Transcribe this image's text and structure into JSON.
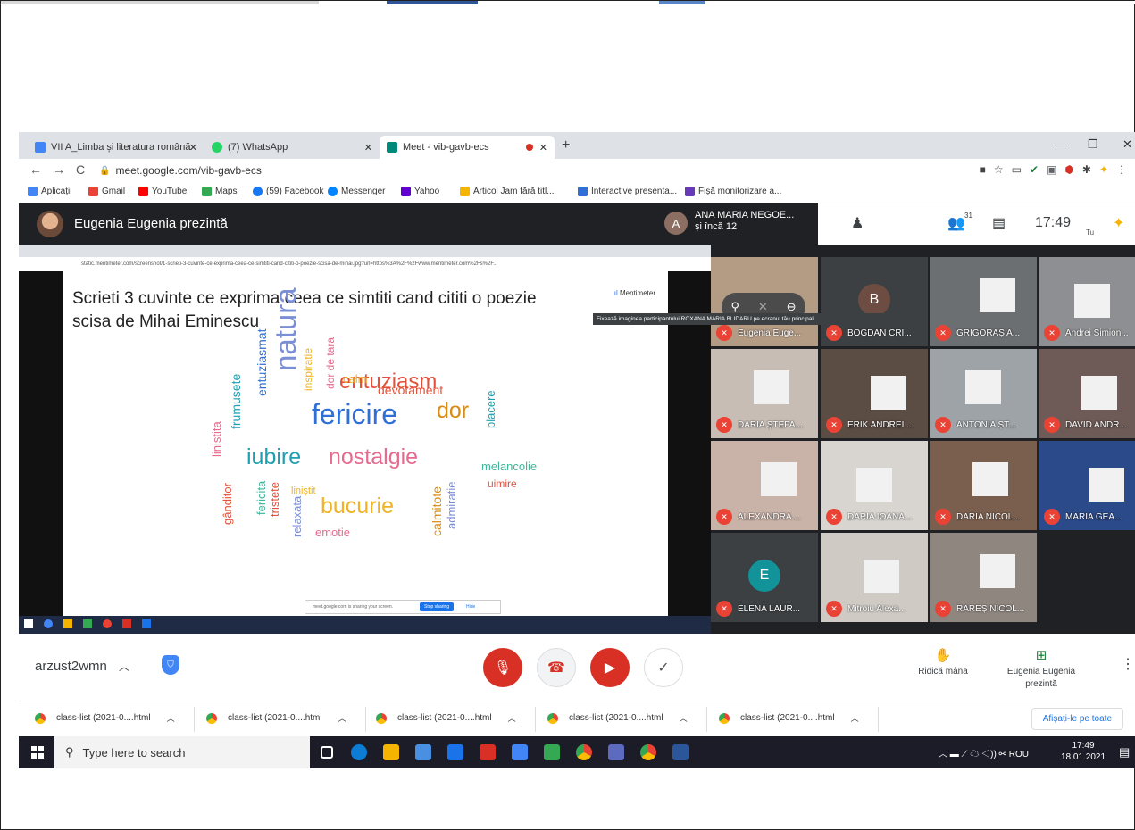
{
  "browser": {
    "tabs": [
      {
        "label": "VII A_Limba și literatura română",
        "color": "#4285f4"
      },
      {
        "label": "(7) WhatsApp",
        "color": "#25d366"
      },
      {
        "label": "Meet - vib-gavb-ecs",
        "color": "#00897b"
      }
    ],
    "url": "meet.google.com/vib-gavb-ecs",
    "bookmarks": [
      "Aplicații",
      "Gmail",
      "YouTube",
      "Maps",
      "(59) Facebook",
      "Messenger",
      "Yahoo",
      "Articol Jam fără titl...",
      "Interactive presenta...",
      "Fișă monitorizare a..."
    ]
  },
  "meet": {
    "presenter_title": "Eugenia Eugenia prezintă",
    "attendee_initial": "A",
    "attendee_name": "ANA MARIA NEGOE...",
    "attendee_more": "și încă 12",
    "people_count": "31",
    "clock": "17:49",
    "you_label": "Tu",
    "meeting_code": "arzust2wmn",
    "raise_hand": "Ridică mâna",
    "presenting_line1": "Eugenia Eugenia",
    "presenting_line2": "prezintă",
    "tooltip": "Fixează imaginea participantului ROXANA MARIA BLIDARU pe ecranul tău principal.",
    "tiles": [
      {
        "name": "Eugenia Euge...",
        "initial": ""
      },
      {
        "name": "BOGDAN CRI...",
        "initial": "B"
      },
      {
        "name": "GRIGORAȘ A...",
        "initial": ""
      },
      {
        "name": "Andrei Simion...",
        "initial": ""
      },
      {
        "name": "DARIA ȘTEFA...",
        "initial": ""
      },
      {
        "name": "ERIK ANDREI ...",
        "initial": ""
      },
      {
        "name": "ANTONIA ȘT...",
        "initial": ""
      },
      {
        "name": "DAVID ANDR...",
        "initial": ""
      },
      {
        "name": "ALEXANDRA ...",
        "initial": ""
      },
      {
        "name": "DARIA IOANA...",
        "initial": ""
      },
      {
        "name": "DARIA NICOL...",
        "initial": ""
      },
      {
        "name": "MARIA GEA...",
        "initial": ""
      },
      {
        "name": "ELENA LAUR...",
        "initial": "E"
      },
      {
        "name": "Mitroiu Alexa...",
        "initial": ""
      },
      {
        "name": "RAREȘ NICOL...",
        "initial": ""
      }
    ]
  },
  "slide": {
    "title": "Scrieti 3 cuvinte ce exprima ceea ce simtiti cand cititi o poezie scisa de Mihai Eminescu",
    "brand": "Mentimeter",
    "inner_url": "static.mentimeter.com/screenshot/1-scrieti-3-cuvinte-ce-exprima-ceea-ce-simtiti-cand-cititi-o-poezie-scisa-de-mihai.jpg?url=https%3A%2F%2Fwww.mentimeter.com%2Fs%2F...",
    "share_text": "meet.google.com is sharing your screen.",
    "stop_sharing": "Stop sharing",
    "hide": "Hide",
    "words": [
      {
        "text": "fericire",
        "color": "#2f6fd6"
      },
      {
        "text": "entuziasm",
        "color": "#e4503a"
      },
      {
        "text": "nostalgie",
        "color": "#e56b8f"
      },
      {
        "text": "iubire",
        "color": "#1f9fb0"
      },
      {
        "text": "dor",
        "color": "#d98b12"
      },
      {
        "text": "bucurie",
        "color": "#f0b323"
      },
      {
        "text": "natura",
        "color": "#7b8fd6"
      },
      {
        "text": "devotament",
        "color": "#e4503a"
      },
      {
        "text": "calm",
        "color": "#f0b323"
      },
      {
        "text": "melancolie",
        "color": "#3fb59a"
      },
      {
        "text": "uimire",
        "color": "#e4503a"
      },
      {
        "text": "emotie",
        "color": "#e56b8f"
      },
      {
        "text": "liniștit",
        "color": "#f0b323"
      },
      {
        "text": "placere",
        "color": "#1f9fb0"
      },
      {
        "text": "frumusete",
        "color": "#1f9fb0"
      },
      {
        "text": "entuziasmat",
        "color": "#2f6fd6"
      },
      {
        "text": "inspiratie",
        "color": "#f0b323"
      },
      {
        "text": "dor de tara",
        "color": "#e56b8f"
      },
      {
        "text": "linistita",
        "color": "#e56b8f"
      },
      {
        "text": "gânditor",
        "color": "#e4503a"
      },
      {
        "text": "fericita",
        "color": "#3fb59a"
      },
      {
        "text": "tristete",
        "color": "#e4503a"
      },
      {
        "text": "relaxata",
        "color": "#7b8fd6"
      },
      {
        "text": "calmitote",
        "color": "#d98b12"
      },
      {
        "text": "admiratie",
        "color": "#7b8fd6"
      }
    ]
  },
  "downloads": {
    "items": [
      "class-list (2021-0....html",
      "class-list (2021-0....html",
      "class-list (2021-0....html",
      "class-list (2021-0....html",
      "class-list (2021-0....html"
    ],
    "show_all": "Afișați-le pe toate"
  },
  "taskbar": {
    "search_placeholder": "Type here to search",
    "lang": "ROU",
    "time": "17:49",
    "date": "18.01.2021"
  }
}
